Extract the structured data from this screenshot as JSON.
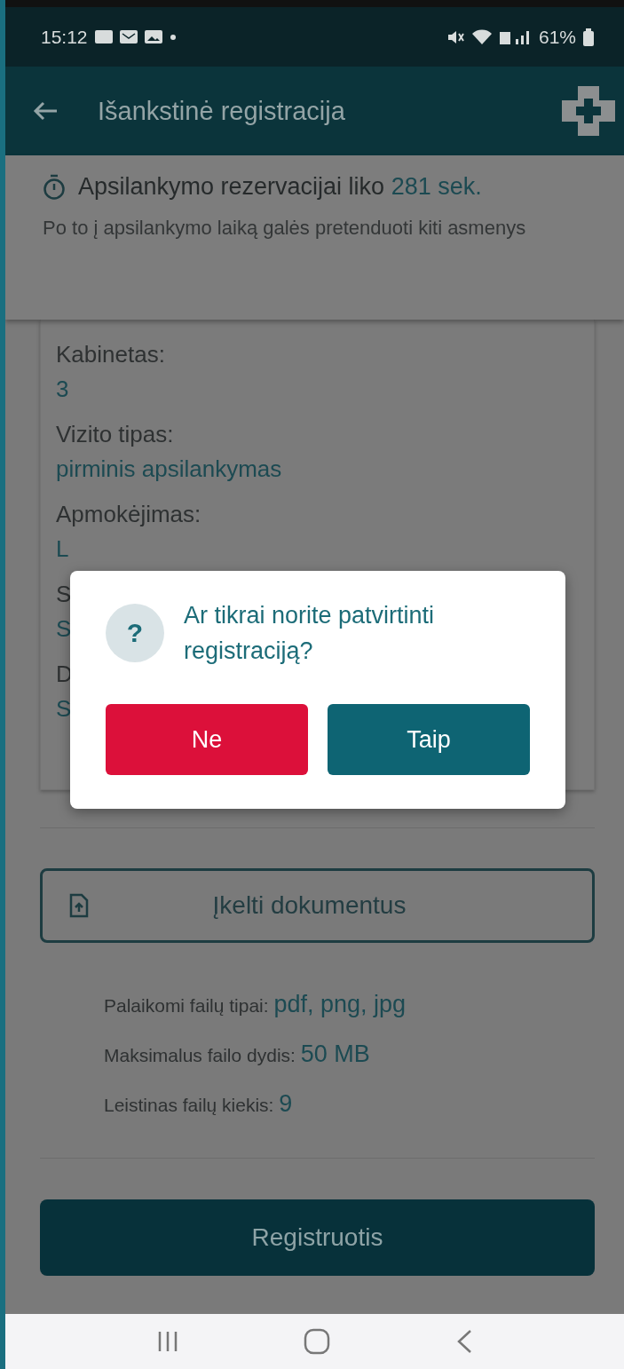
{
  "status_bar": {
    "time": "15:12",
    "battery": "61%"
  },
  "app_bar": {
    "title": "Išankstinė registracija"
  },
  "timer": {
    "text": "Apsilankymo rezervacijai liko",
    "seconds": "281 sek.",
    "note": "Po to į apsilankymo laiką galės pretenduoti kiti asmenys"
  },
  "details": [
    {
      "label": "Kabinetas:",
      "value": "3"
    },
    {
      "label": "Vizito tipas:",
      "value": "pirminis apsilankymas"
    },
    {
      "label": "Apmokėjimas:",
      "value": "L"
    },
    {
      "label": "S",
      "value": "S"
    },
    {
      "label": "D",
      "value": "S"
    }
  ],
  "dialog": {
    "question": "Ar tikrai norite patvirtinti registraciją?",
    "icon": "?",
    "buttons": [
      {
        "label": "Ne",
        "kind": "cancel"
      },
      {
        "label": "Taip",
        "kind": "confirm"
      }
    ]
  },
  "upload_button": "Įkelti dokumentus",
  "file_info": [
    {
      "label": "Palaikomi failų tipai:",
      "value": "pdf, png, jpg"
    },
    {
      "label": "Maksimalus failo dydis:",
      "value": "50 MB"
    },
    {
      "label": "Leistinas failų kiekis:",
      "value": "9"
    }
  ],
  "submit_button": "Registruotis"
}
